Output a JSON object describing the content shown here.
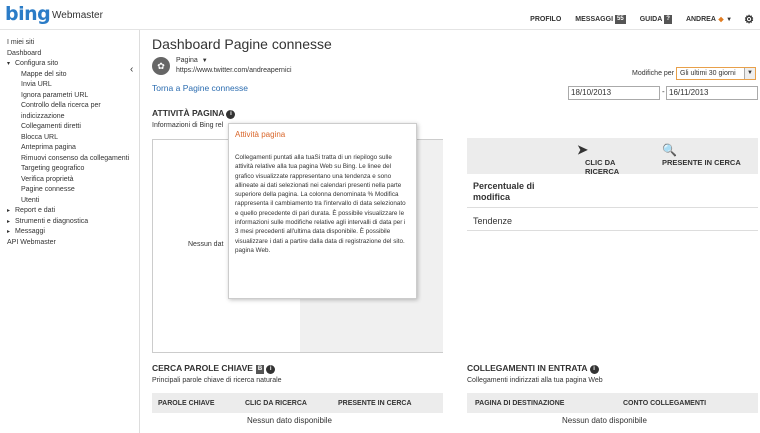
{
  "topbar": {
    "logo": "bing",
    "brand": "Webmaster",
    "nav": [
      {
        "label": "PROFILO",
        "badge": ""
      },
      {
        "label": "MESSAGGI",
        "badge": "55"
      },
      {
        "label": "GUIDA",
        "badge": "?"
      },
      {
        "label": "ANDREA",
        "badge": ""
      }
    ]
  },
  "sidebar": {
    "items": [
      {
        "label": "I miei siti"
      },
      {
        "label": "Dashboard"
      },
      {
        "label": "Configura sito"
      },
      {
        "label": "Mappe del sito"
      },
      {
        "label": "Invia URL"
      },
      {
        "label": "Ignora parametri URL"
      },
      {
        "label": "Controllo della ricerca per indicizzazione"
      },
      {
        "label": "Collegamenti diretti"
      },
      {
        "label": "Blocca URL"
      },
      {
        "label": "Anteprima pagina"
      },
      {
        "label": "Rimuovi consenso da collegamenti"
      },
      {
        "label": "Targeting geografico"
      },
      {
        "label": "Verifica proprietà"
      },
      {
        "label": "Pagine connesse"
      },
      {
        "label": "Utenti"
      },
      {
        "label": "Report e dati"
      },
      {
        "label": "Strumenti e diagnostica"
      },
      {
        "label": "Messaggi"
      },
      {
        "label": "API Webmaster"
      }
    ]
  },
  "main": {
    "title": "Dashboard Pagine connesse",
    "site_type": "Pagina",
    "site_url": "https://www.twitter.com/andreapernici",
    "back_link": "Torna a Pagine connesse",
    "modifiche_label": "Modifiche per",
    "modifiche_value": "Gli ultimi 30 giorni",
    "date_from": "18/10/2013",
    "date_sep": "-",
    "date_to": "16/11/2013"
  },
  "activity": {
    "title": "ATTIVITÀ PAGINA",
    "subtitle": "Informazioni di Bing rel",
    "empty": "Nessun dat",
    "popup_title": "Attività pagina",
    "popup_body": "Collegamenti puntati alla tuaSi tratta di un riepilogo sulle attività relative alla tua pagina Web su Bing. Le linee del grafico visualizzate rappresentano una tendenza e sono allineate ai dati selezionati nei calendari presenti nella parte superiore della pagina. La colonna denominata % Modifica rappresenta il cambiamento tra l'intervallo di data selezionato e quello precedente di pari durata. È possibile visualizzare le informazioni sulle modifiche relative agli intervalli di data per i 3 mesi precedenti all'ultima data disponibile. È possibile visualizzare i dati a partire dalla data di registrazione del sito. pagina Web."
  },
  "stats": {
    "click_header": "CLIC DA RICERCA",
    "presence_header": "PRESENTE IN CERCA",
    "percent_label": "Percentuale di modifica",
    "trend_label": "Tendenze"
  },
  "keywords": {
    "title": "CERCA PAROLE CHIAVE",
    "subtitle": "Principali parole chiave di ricerca naturale",
    "col1": "PAROLE CHIAVE",
    "col2": "CLIC DA RICERCA",
    "col3": "PRESENTE IN CERCA",
    "empty": "Nessun dato disponibile"
  },
  "inbound": {
    "title": "COLLEGAMENTI IN ENTRATA",
    "subtitle": "Collegamenti indirizzati alla tua pagina Web",
    "col1": "PAGINA DI DESTINAZIONE",
    "col2": "CONTO COLLEGAMENTI",
    "empty": "Nessun dato disponibile"
  }
}
